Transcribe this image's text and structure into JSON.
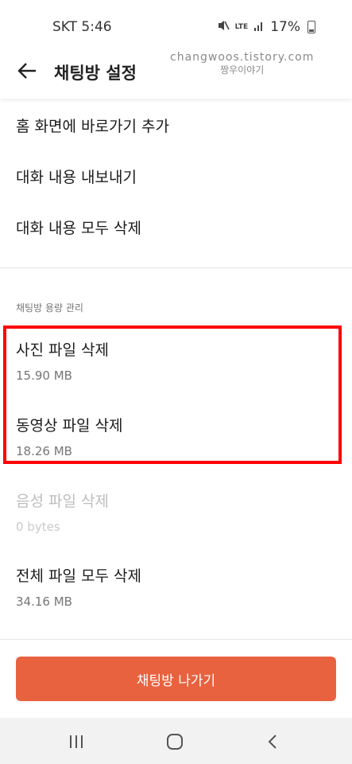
{
  "status_bar": {
    "carrier_time": "SKT 5:46",
    "network": "LTE",
    "battery": "17%",
    "icons": [
      "mute-vibrate-icon",
      "lte-icon",
      "signal-icon",
      "battery-icon"
    ]
  },
  "header": {
    "title": "채팅방 설정",
    "back_icon": "back-arrow-icon"
  },
  "watermark": {
    "line1": "changwoos.tistory.com",
    "line2": "짱우이야기"
  },
  "menu": {
    "items": [
      {
        "label": "홈 화면에 바로가기 추가"
      },
      {
        "label": "대화 내용 내보내기"
      },
      {
        "label": "대화 내용 모두 삭제"
      }
    ]
  },
  "storage": {
    "section_label": "채팅방 용량 관리",
    "files": [
      {
        "label": "사진 파일 삭제",
        "size": "15.90 MB",
        "enabled": true
      },
      {
        "label": "동영상 파일 삭제",
        "size": "18.26 MB",
        "enabled": true
      },
      {
        "label": "음성 파일 삭제",
        "size": "0 bytes",
        "enabled": false
      },
      {
        "label": "전체 파일 모두 삭제",
        "size": "34.16 MB",
        "enabled": true
      }
    ]
  },
  "actions": {
    "exit_label": "채팅방 나가기",
    "exit_color": "#e8623f"
  },
  "highlight_color": "#ff0000",
  "nav": {
    "icons": [
      "recent-apps-icon",
      "home-icon",
      "back-icon"
    ]
  }
}
